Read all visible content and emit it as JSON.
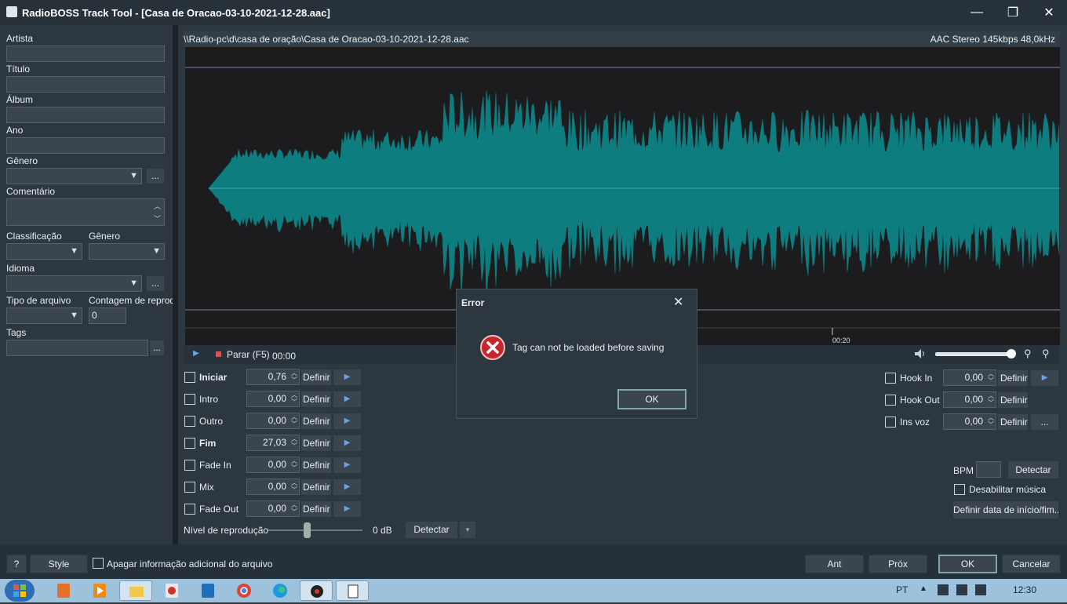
{
  "window": {
    "title": "RadioBOSS Track Tool - [Casa de Oracao-03-10-2021-12-28.aac]",
    "minimize": "—",
    "maximize": "❐",
    "close": "✕"
  },
  "left": {
    "artista": "Artista",
    "titulo": "Título",
    "album": "Álbum",
    "ano": "Ano",
    "genero": "Gênero",
    "comentario": "Comentário",
    "classificacao": "Classificação",
    "genero2": "Gênero",
    "idioma": "Idioma",
    "tipo_arquivo": "Tipo de arquivo",
    "contagem": "Contagem de reprod",
    "contagem_value": "0",
    "tags": "Tags",
    "more": "..."
  },
  "wave": {
    "path": "\\\\Radio-pc\\d\\casa de oração\\Casa de Oracao-03-10-2021-12-28.aac",
    "info": "AAC Stereo 145kbps 48,0kHz",
    "tick": "00:20"
  },
  "transport": {
    "play": "▶",
    "stop_label": "Parar (F5)",
    "time": "00:00"
  },
  "markers": [
    {
      "label": "Iniciar",
      "value": "0,76",
      "bold": true
    },
    {
      "label": "Intro",
      "value": "0,00",
      "bold": false
    },
    {
      "label": "Outro",
      "value": "0,00",
      "bold": false
    },
    {
      "label": "Fim",
      "value": "27,03",
      "bold": true
    },
    {
      "label": "Fade In",
      "value": "0,00",
      "bold": false
    },
    {
      "label": "Mix",
      "value": "0,00",
      "bold": false
    },
    {
      "label": "Fade Out",
      "value": "0,00",
      "bold": false
    }
  ],
  "define": "Definir",
  "hooks": [
    {
      "label": "Hook In",
      "value": "0,00",
      "btn": "▶"
    },
    {
      "label": "Hook Out",
      "value": "0,00",
      "btn": ""
    },
    {
      "label": "Ins voz",
      "value": "0,00",
      "btn": "..."
    }
  ],
  "level": {
    "label": "Nível de reprodução",
    "value": "0 dB",
    "detect": "Detectar"
  },
  "bpm": {
    "label": "BPM",
    "detect": "Detectar",
    "disable": "Desabilitar música",
    "define_date": "Definir data de início/fim..."
  },
  "bottom": {
    "help": "?",
    "style": "Style",
    "erase": "Apagar informação adicional do arquivo",
    "prev": "Ant",
    "next": "Próx",
    "ok": "OK",
    "cancel": "Cancelar"
  },
  "dialog": {
    "title": "Error",
    "message": "Tag can not be loaded before saving",
    "ok": "OK",
    "close": "✕"
  },
  "taskbar": {
    "lang": "PT",
    "time": "12:30"
  },
  "colors": {
    "wave": "#0d7d80",
    "accent": "#6aa3e6",
    "error": "#c8242b"
  }
}
